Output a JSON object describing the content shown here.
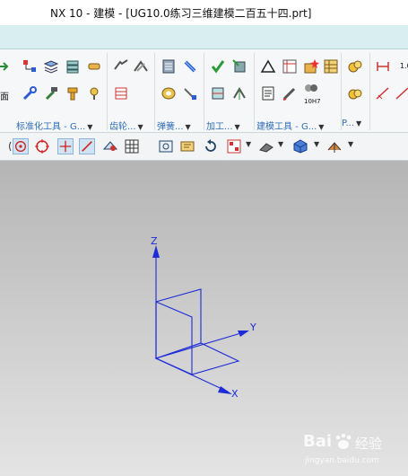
{
  "window": {
    "title": "NX 10 - 建模 - [UG10.0练习三维建模二百五十四.prt]"
  },
  "ribbon": {
    "groups": [
      {
        "label": "标准化工具 - G..."
      },
      {
        "label": "齿轮..."
      },
      {
        "label": "弹簧..."
      },
      {
        "label": "加工..."
      },
      {
        "label": "建模工具 - G..."
      },
      {
        "label": "P..."
      }
    ],
    "icon_text": {
      "fit_label": "10H7",
      "scale_label": "1.0"
    }
  },
  "toolbar": {
    "icons": [
      "arc-icon",
      "point-on-circle-icon",
      "circle-snap-icon",
      "crosshair-icon",
      "line-icon",
      "view-icon",
      "grid-icon",
      "camera-icon",
      "render-icon",
      "rotate-icon",
      "layout-icon",
      "shading-icon",
      "cube-icon",
      "section-icon"
    ]
  },
  "viewport": {
    "axes": {
      "z": "Z",
      "y": "Y",
      "x": "X"
    },
    "axis_color": "#1d2bd8",
    "background_top": "#b5b5b5",
    "background_bottom": "#e4e4e4"
  },
  "watermark": {
    "logo_text": "Bai",
    "brand": "经验",
    "url": "jingyan.baidu.com"
  }
}
